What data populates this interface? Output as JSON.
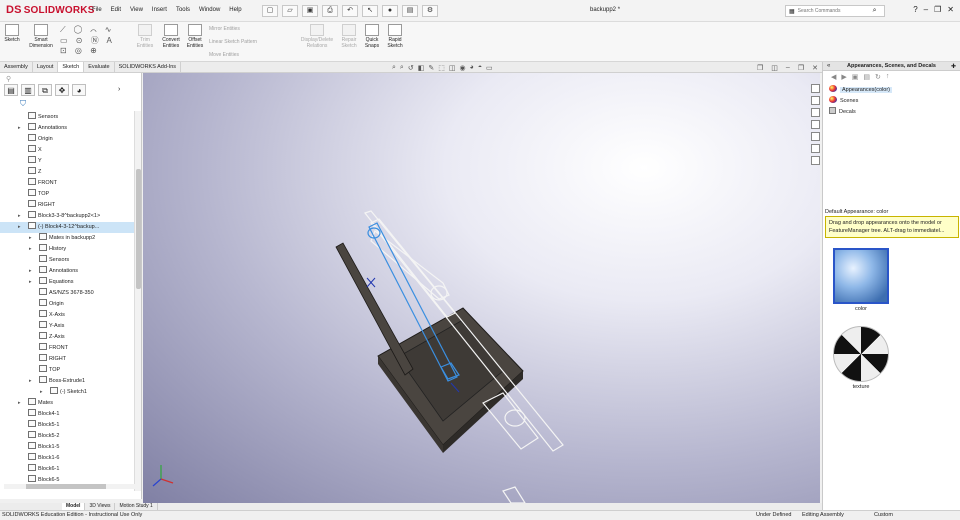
{
  "app": {
    "brand_ds": "DS",
    "brand": "SOLIDWORKS",
    "document_title": "backupp2 *"
  },
  "menu": [
    "File",
    "Edit",
    "View",
    "Insert",
    "Tools",
    "Window",
    "Help"
  ],
  "search": {
    "placeholder": "Search Commands"
  },
  "ribbon": {
    "sketch": "Sketch",
    "smart_dimension_1": "Smart",
    "smart_dimension_2": "Dimension",
    "trim_1": "Trim",
    "trim_2": "Entities",
    "convert_1": "Convert",
    "convert_2": "Entities",
    "offset_1": "Offset",
    "offset_2": "Entities",
    "mirror": "Mirror Entities",
    "linear_pattern": "Linear Sketch Pattern",
    "move": "Move Entities",
    "display_delete_1": "Display/Delete",
    "display_delete_2": "Relations",
    "repair_1": "Repair",
    "repair_2": "Sketch",
    "quick_snaps_1": "Quick",
    "quick_snaps_2": "Snaps",
    "rapid_sketch_1": "Rapid",
    "rapid_sketch_2": "Sketch"
  },
  "command_tabs": [
    "Assembly",
    "Layout",
    "Sketch",
    "Evaluate",
    "SOLIDWORKS Add-Ins"
  ],
  "feature_tree": [
    {
      "label": "Sensors",
      "indent": 1
    },
    {
      "label": "Annotations",
      "indent": 1,
      "arrow": true
    },
    {
      "label": "Origin",
      "indent": 1
    },
    {
      "label": "X",
      "indent": 1
    },
    {
      "label": "Y",
      "indent": 1
    },
    {
      "label": "Z",
      "indent": 1
    },
    {
      "label": "FRONT",
      "indent": 1
    },
    {
      "label": "TOP",
      "indent": 1
    },
    {
      "label": "RIGHT",
      "indent": 1
    },
    {
      "label": "Block3-3-8^backupp2<1>",
      "indent": 1,
      "arrow": true
    },
    {
      "label": "(-) Block4-3-12^backup...",
      "indent": 1,
      "arrow": true,
      "selected": true
    },
    {
      "label": "Mates in backupp2",
      "indent": 2,
      "arrow": true
    },
    {
      "label": "History",
      "indent": 2,
      "arrow": true
    },
    {
      "label": "Sensors",
      "indent": 2
    },
    {
      "label": "Annotations",
      "indent": 2,
      "arrow": true
    },
    {
      "label": "Equations",
      "indent": 2,
      "arrow": true
    },
    {
      "label": "AS/NZS 3678-350",
      "indent": 2
    },
    {
      "label": "Origin",
      "indent": 2
    },
    {
      "label": "X-Axis",
      "indent": 2
    },
    {
      "label": "Y-Axis",
      "indent": 2
    },
    {
      "label": "Z-Axis",
      "indent": 2
    },
    {
      "label": "FRONT",
      "indent": 2
    },
    {
      "label": "RIGHT",
      "indent": 2
    },
    {
      "label": "TOP",
      "indent": 2
    },
    {
      "label": "Boss-Extrude1",
      "indent": 2,
      "arrow": true
    },
    {
      "label": "(-) Sketch1",
      "indent": 3,
      "arrow": true
    },
    {
      "label": "Mates",
      "indent": 1,
      "arrow": true
    },
    {
      "label": "Block4-1",
      "indent": 1
    },
    {
      "label": "Block5-1",
      "indent": 1
    },
    {
      "label": "Block5-2",
      "indent": 1
    },
    {
      "label": "Block1-5",
      "indent": 1
    },
    {
      "label": "Block1-6",
      "indent": 1
    },
    {
      "label": "Block6-1",
      "indent": 1
    },
    {
      "label": "Block6-5",
      "indent": 1
    }
  ],
  "bottom_tabs": [
    "Model",
    "3D Views",
    "Motion Study 1"
  ],
  "status": {
    "left": "SOLIDWORKS Education Edition - Instructional Use Only",
    "under_defined": "Under Defined",
    "mode": "Editing Assembly",
    "units": "Custom"
  },
  "right_pane": {
    "title": "Appearances, Scenes, and Decals",
    "tree": [
      "Appearances(color)",
      "Scenes",
      "Decals"
    ],
    "default_label": "Default Appearance: color",
    "hint": "Drag and drop appearances onto the model or FeatureManager tree. ALT-drag to immediatel...",
    "swatches": [
      "color",
      "texture"
    ]
  },
  "colors": {
    "brand_red": "#c8102e",
    "selection_blue": "#2a55c8",
    "hint_yellow": "#ffffc8",
    "sketch_blue": "#3b8fe0",
    "part_dark": "#4a4540"
  }
}
